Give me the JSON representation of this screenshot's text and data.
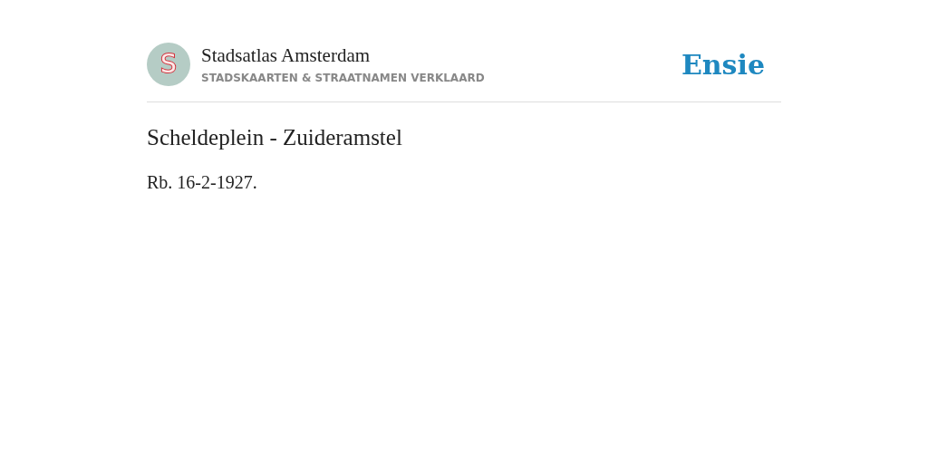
{
  "header": {
    "logo_letter": "S",
    "site_title": "Stadsatlas Amsterdam",
    "tagline": "STADSKAARTEN & STRAATNAMEN VERKLAARD",
    "brand": "Ensie"
  },
  "article": {
    "title": "Scheldeplein - Zuideramstel",
    "body": "Rb. 16-2-1927."
  }
}
